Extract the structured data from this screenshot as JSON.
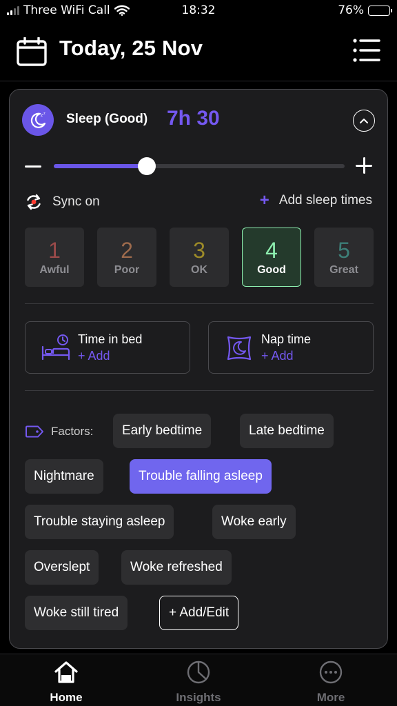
{
  "status_bar": {
    "carrier": "Three WiFi Call",
    "time": "18:32",
    "battery": "76%",
    "battery_level": 0.76
  },
  "header": {
    "title": "Today, 25 Nov",
    "calendar_icon": "calendar-icon",
    "menu_icon": "list-menu-icon"
  },
  "sleep": {
    "label": "Sleep (Good)",
    "duration": "7h 30",
    "slider_fraction": 0.32,
    "colors": {
      "accent": "#7458f0",
      "selected_border": "#8ef0b0"
    }
  },
  "sync": {
    "label": "Sync on"
  },
  "add_sleep_times": {
    "label": "Add sleep times"
  },
  "ratings": [
    {
      "num": "1",
      "label": "Awful",
      "color": "#9a4a4a",
      "selected": false
    },
    {
      "num": "2",
      "label": "Poor",
      "color": "#9c6a4c",
      "selected": false
    },
    {
      "num": "3",
      "label": "OK",
      "color": "#9c8a28",
      "selected": false
    },
    {
      "num": "4",
      "label": "Good",
      "color": "#8ef0b0",
      "selected": true
    },
    {
      "num": "5",
      "label": "Great",
      "color": "#3d7f78",
      "selected": false
    }
  ],
  "tiles": {
    "time_in_bed": {
      "label": "Time in bed",
      "add": "+ Add"
    },
    "nap_time": {
      "label": "Nap time",
      "add": "+ Add"
    }
  },
  "factors": {
    "label": "Factors:",
    "chips": [
      {
        "label": "Early bedtime",
        "active": false
      },
      {
        "label": "Late bedtime",
        "active": false
      },
      {
        "label": "Nightmare",
        "active": false
      },
      {
        "label": "Trouble falling asleep",
        "active": true
      },
      {
        "label": "Trouble staying asleep",
        "active": false
      },
      {
        "label": "Woke early",
        "active": false
      },
      {
        "label": "Overslept",
        "active": false
      },
      {
        "label": "Woke refreshed",
        "active": false
      },
      {
        "label": "Woke still tired",
        "active": false
      }
    ],
    "add_edit": "+ Add/Edit"
  },
  "tabs": [
    {
      "label": "Home",
      "icon": "home-icon",
      "active": true
    },
    {
      "label": "Insights",
      "icon": "pie-chart-icon",
      "active": false
    },
    {
      "label": "More",
      "icon": "more-dots-icon",
      "active": false
    }
  ]
}
